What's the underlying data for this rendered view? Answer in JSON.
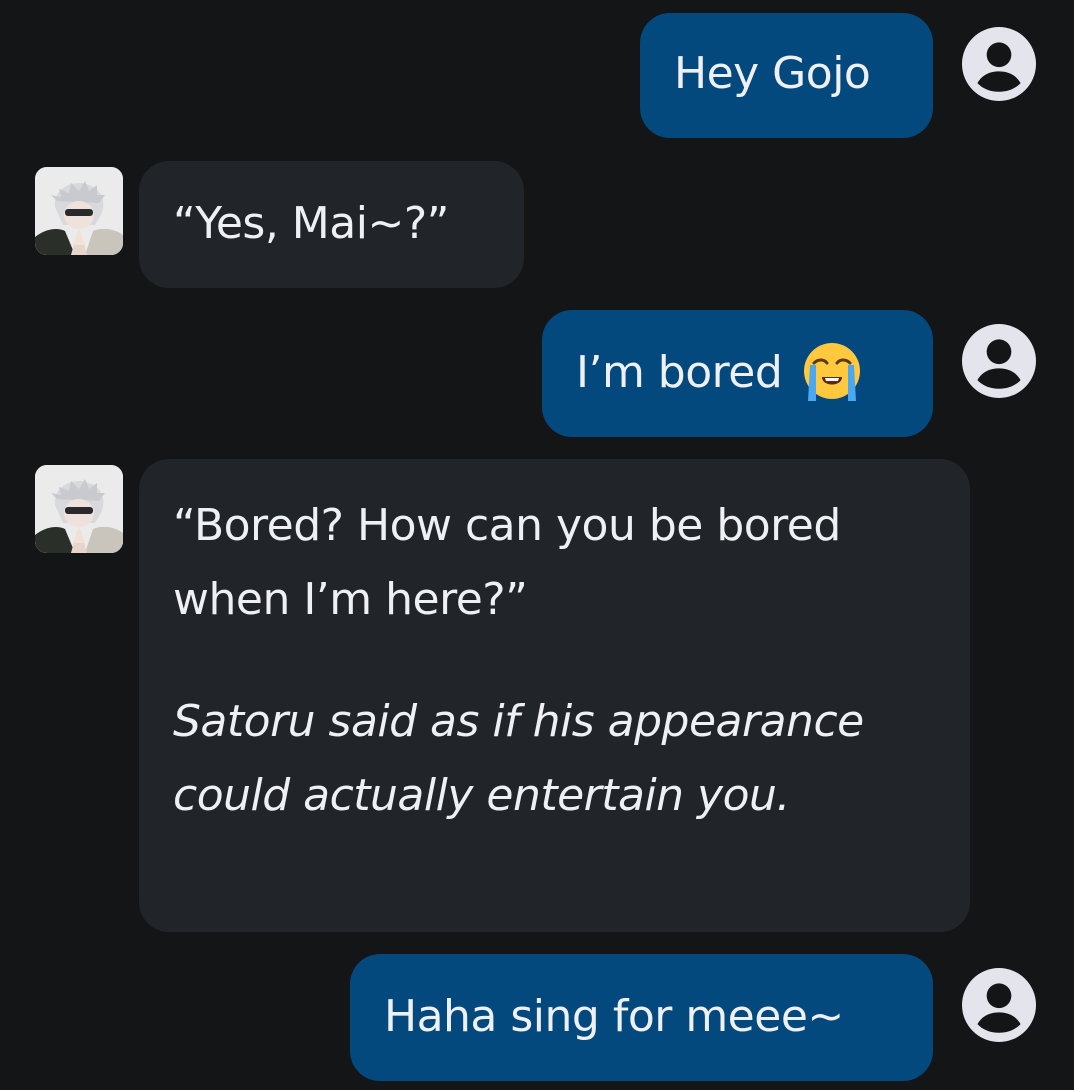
{
  "conversation": {
    "messages": [
      {
        "sender": "user",
        "text": "Hey Gojo"
      },
      {
        "sender": "character",
        "text": "“Yes, Mai~?”"
      },
      {
        "sender": "user",
        "text": "I’m bored",
        "emoji": "loudly-crying-face"
      },
      {
        "sender": "character",
        "line1": "“Bored? How can you be bored when I’m here?”",
        "line2": "Satoru said as if his appearance could actually entertain you."
      },
      {
        "sender": "user",
        "text": "Haha sing for meee~"
      }
    ]
  },
  "colors": {
    "background": "#141517",
    "user_bubble": "#03497d",
    "character_bubble": "#212429",
    "text": "#eef0f3",
    "user_avatar_icon": "#e4e4ec"
  },
  "icons": {
    "user_avatar": "account-circle-icon",
    "character_avatar": "character-portrait"
  }
}
